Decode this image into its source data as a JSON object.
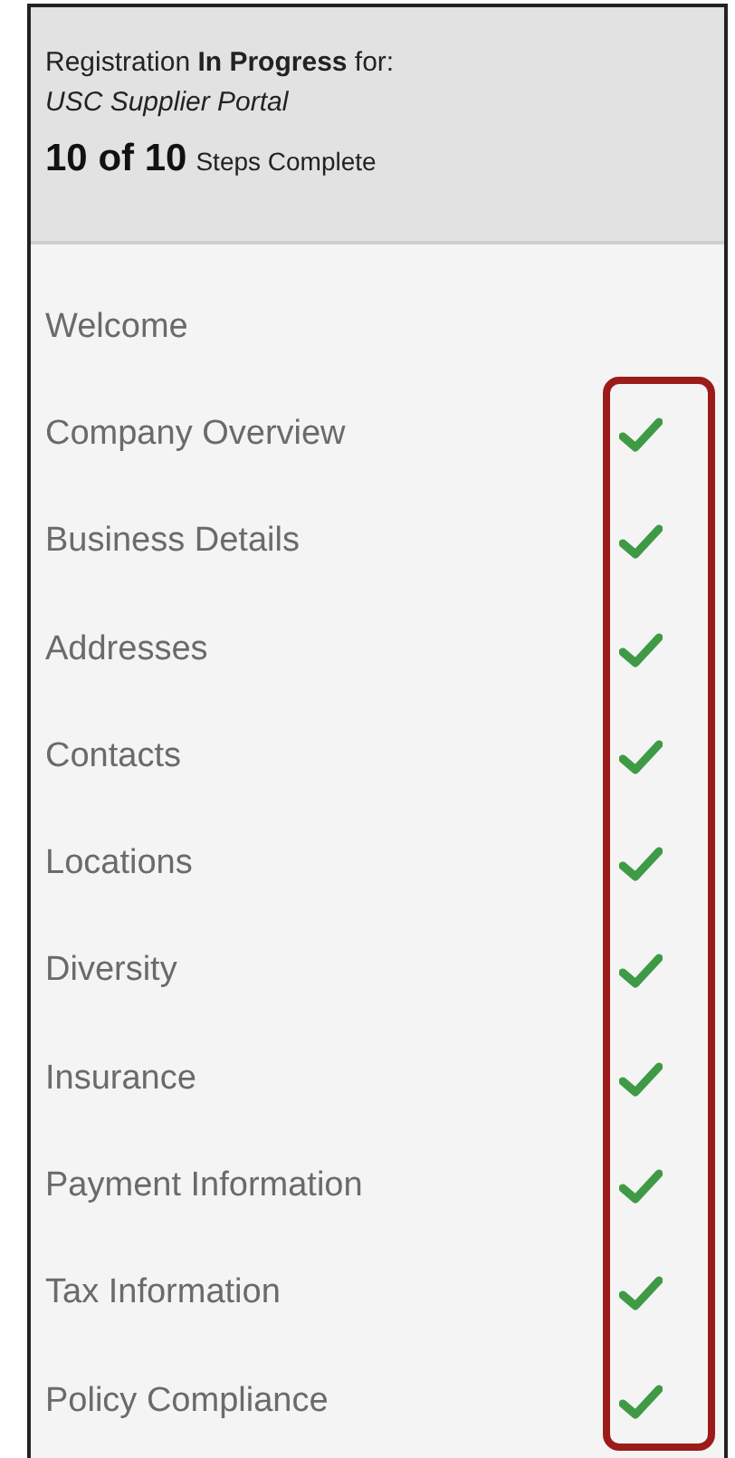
{
  "header": {
    "status_line": "Registration **In Progress** for:",
    "portal": "USC Supplier Portal",
    "count": "10 of 10",
    "count_label": "Steps Complete"
  },
  "steps": [
    {
      "label": "Welcome",
      "completed": false
    },
    {
      "label": "Company Overview",
      "completed": true
    },
    {
      "label": "Business Details",
      "completed": true
    },
    {
      "label": "Addresses",
      "completed": true
    },
    {
      "label": "Contacts",
      "completed": true
    },
    {
      "label": "Locations",
      "completed": true
    },
    {
      "label": "Diversity",
      "completed": true
    },
    {
      "label": "Insurance",
      "completed": true
    },
    {
      "label": "Payment Information",
      "completed": true
    },
    {
      "label": "Tax Information",
      "completed": true
    },
    {
      "label": "Policy Compliance",
      "completed": true
    }
  ]
}
